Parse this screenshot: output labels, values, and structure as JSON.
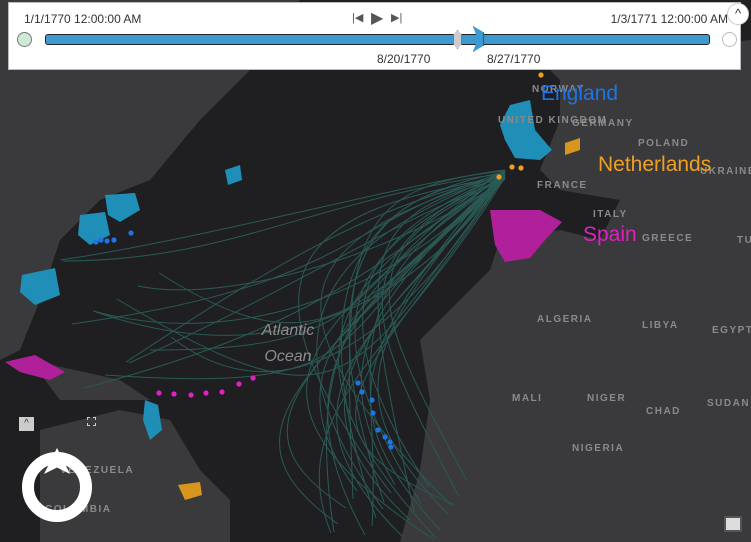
{
  "time_slider": {
    "start_label": "1/1/1770 12:00:00 AM",
    "end_label": "1/3/1771 12:00:00 AM",
    "current_start": "8/20/1770",
    "current_end": "8/27/1770",
    "progress_start_fraction": 0.62,
    "progress_end_fraction": 0.64,
    "collapse_glyph": "^"
  },
  "map": {
    "ocean_label": "Atlantic Ocean",
    "countries": [
      "NORWAY",
      "UNITED KINGDOM",
      "GERMANY",
      "POLAND",
      "UKRAINE",
      "FRANCE",
      "ITALY",
      "GREECE",
      "TU",
      "ALGERIA",
      "LIBYA",
      "EGYPT",
      "MALI",
      "NIGER",
      "CHAD",
      "SUDAN",
      "NIGERIA",
      "VENEZUELA",
      "COLOMBIA"
    ],
    "nations": [
      {
        "name": "England",
        "color": "#1e74e6"
      },
      {
        "name": "Netherlands",
        "color": "#f0a020"
      },
      {
        "name": "Spain",
        "color": "#e020c0"
      }
    ]
  },
  "colors": {
    "england_territory": "#1f8fb8",
    "netherlands_territory": "#d8961c",
    "spain_territory": "#b0209a",
    "track": "#2a5a55"
  }
}
